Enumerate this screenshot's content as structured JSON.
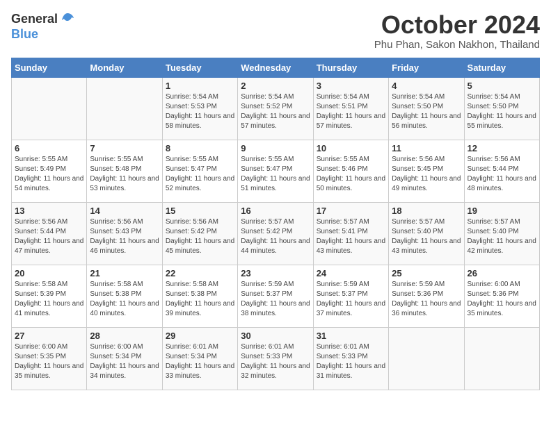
{
  "logo": {
    "general": "General",
    "blue": "Blue"
  },
  "title": "October 2024",
  "location": "Phu Phan, Sakon Nakhon, Thailand",
  "days_of_week": [
    "Sunday",
    "Monday",
    "Tuesday",
    "Wednesday",
    "Thursday",
    "Friday",
    "Saturday"
  ],
  "weeks": [
    [
      {
        "day": "",
        "info": ""
      },
      {
        "day": "",
        "info": ""
      },
      {
        "day": "1",
        "sunrise": "5:54 AM",
        "sunset": "5:53 PM",
        "daylight": "11 hours and 58 minutes."
      },
      {
        "day": "2",
        "sunrise": "5:54 AM",
        "sunset": "5:52 PM",
        "daylight": "11 hours and 57 minutes."
      },
      {
        "day": "3",
        "sunrise": "5:54 AM",
        "sunset": "5:51 PM",
        "daylight": "11 hours and 57 minutes."
      },
      {
        "day": "4",
        "sunrise": "5:54 AM",
        "sunset": "5:50 PM",
        "daylight": "11 hours and 56 minutes."
      },
      {
        "day": "5",
        "sunrise": "5:54 AM",
        "sunset": "5:50 PM",
        "daylight": "11 hours and 55 minutes."
      }
    ],
    [
      {
        "day": "6",
        "sunrise": "5:55 AM",
        "sunset": "5:49 PM",
        "daylight": "11 hours and 54 minutes."
      },
      {
        "day": "7",
        "sunrise": "5:55 AM",
        "sunset": "5:48 PM",
        "daylight": "11 hours and 53 minutes."
      },
      {
        "day": "8",
        "sunrise": "5:55 AM",
        "sunset": "5:47 PM",
        "daylight": "11 hours and 52 minutes."
      },
      {
        "day": "9",
        "sunrise": "5:55 AM",
        "sunset": "5:47 PM",
        "daylight": "11 hours and 51 minutes."
      },
      {
        "day": "10",
        "sunrise": "5:55 AM",
        "sunset": "5:46 PM",
        "daylight": "11 hours and 50 minutes."
      },
      {
        "day": "11",
        "sunrise": "5:56 AM",
        "sunset": "5:45 PM",
        "daylight": "11 hours and 49 minutes."
      },
      {
        "day": "12",
        "sunrise": "5:56 AM",
        "sunset": "5:44 PM",
        "daylight": "11 hours and 48 minutes."
      }
    ],
    [
      {
        "day": "13",
        "sunrise": "5:56 AM",
        "sunset": "5:44 PM",
        "daylight": "11 hours and 47 minutes."
      },
      {
        "day": "14",
        "sunrise": "5:56 AM",
        "sunset": "5:43 PM",
        "daylight": "11 hours and 46 minutes."
      },
      {
        "day": "15",
        "sunrise": "5:56 AM",
        "sunset": "5:42 PM",
        "daylight": "11 hours and 45 minutes."
      },
      {
        "day": "16",
        "sunrise": "5:57 AM",
        "sunset": "5:42 PM",
        "daylight": "11 hours and 44 minutes."
      },
      {
        "day": "17",
        "sunrise": "5:57 AM",
        "sunset": "5:41 PM",
        "daylight": "11 hours and 43 minutes."
      },
      {
        "day": "18",
        "sunrise": "5:57 AM",
        "sunset": "5:40 PM",
        "daylight": "11 hours and 43 minutes."
      },
      {
        "day": "19",
        "sunrise": "5:57 AM",
        "sunset": "5:40 PM",
        "daylight": "11 hours and 42 minutes."
      }
    ],
    [
      {
        "day": "20",
        "sunrise": "5:58 AM",
        "sunset": "5:39 PM",
        "daylight": "11 hours and 41 minutes."
      },
      {
        "day": "21",
        "sunrise": "5:58 AM",
        "sunset": "5:38 PM",
        "daylight": "11 hours and 40 minutes."
      },
      {
        "day": "22",
        "sunrise": "5:58 AM",
        "sunset": "5:38 PM",
        "daylight": "11 hours and 39 minutes."
      },
      {
        "day": "23",
        "sunrise": "5:59 AM",
        "sunset": "5:37 PM",
        "daylight": "11 hours and 38 minutes."
      },
      {
        "day": "24",
        "sunrise": "5:59 AM",
        "sunset": "5:37 PM",
        "daylight": "11 hours and 37 minutes."
      },
      {
        "day": "25",
        "sunrise": "5:59 AM",
        "sunset": "5:36 PM",
        "daylight": "11 hours and 36 minutes."
      },
      {
        "day": "26",
        "sunrise": "6:00 AM",
        "sunset": "5:36 PM",
        "daylight": "11 hours and 35 minutes."
      }
    ],
    [
      {
        "day": "27",
        "sunrise": "6:00 AM",
        "sunset": "5:35 PM",
        "daylight": "11 hours and 35 minutes."
      },
      {
        "day": "28",
        "sunrise": "6:00 AM",
        "sunset": "5:34 PM",
        "daylight": "11 hours and 34 minutes."
      },
      {
        "day": "29",
        "sunrise": "6:01 AM",
        "sunset": "5:34 PM",
        "daylight": "11 hours and 33 minutes."
      },
      {
        "day": "30",
        "sunrise": "6:01 AM",
        "sunset": "5:33 PM",
        "daylight": "11 hours and 32 minutes."
      },
      {
        "day": "31",
        "sunrise": "6:01 AM",
        "sunset": "5:33 PM",
        "daylight": "11 hours and 31 minutes."
      },
      {
        "day": "",
        "info": ""
      },
      {
        "day": "",
        "info": ""
      }
    ]
  ]
}
